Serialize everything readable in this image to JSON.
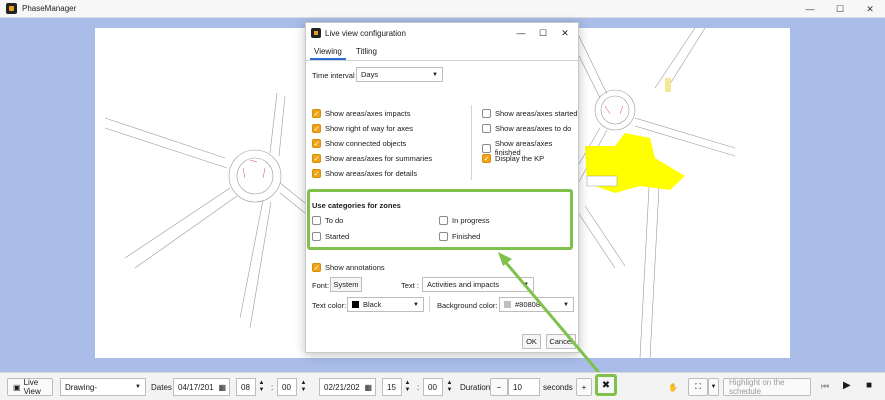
{
  "app": {
    "title": "PhaseManager"
  },
  "window_controls": {
    "minimize": "—",
    "maximize": "☐",
    "close": "✕"
  },
  "dialog": {
    "title": "Live view configuration",
    "controls": {
      "minimize": "—",
      "maximize": "☐",
      "close": "✕"
    },
    "tabs": [
      "Viewing",
      "Titling"
    ],
    "time_interval": {
      "label": "Time interval",
      "value": "Days"
    },
    "left_checks": [
      {
        "label": "Show areas/axes impacts",
        "checked": true
      },
      {
        "label": "Show right of way for axes",
        "checked": true
      },
      {
        "label": "Show connected objects",
        "checked": true
      },
      {
        "label": "Show areas/axes for summaries",
        "checked": true
      },
      {
        "label": "Show areas/axes for details",
        "checked": true
      }
    ],
    "right_checks": [
      {
        "label": "Show areas/axes started",
        "checked": false
      },
      {
        "label": "Show areas/axes to do",
        "checked": false
      },
      {
        "label": "Show areas/axes finished",
        "checked": false
      },
      {
        "label": "Display the KP",
        "checked": true
      }
    ],
    "zones": {
      "title": "Use categories for zones",
      "items": [
        {
          "label": "To do",
          "checked": false
        },
        {
          "label": "In progress",
          "checked": false
        },
        {
          "label": "Started",
          "checked": false
        },
        {
          "label": "Finished",
          "checked": false
        }
      ]
    },
    "show_annotations": {
      "label": "Show annotations",
      "checked": true
    },
    "font": {
      "label": "Font:",
      "button": "System"
    },
    "text": {
      "label": "Text :",
      "value": "Activities and impacts"
    },
    "text_color": {
      "label": "Text color:",
      "value": "Black",
      "color": "#000000"
    },
    "background_color": {
      "label": "Background color:",
      "value": "#80808",
      "color": "#c0c0c0"
    },
    "ok_label": "OK",
    "cancel_label": "Cancel"
  },
  "toolbar": {
    "live_view": "Live View",
    "drawing": "Drawing-",
    "dates_label": "Dates",
    "start_date": "04/17/201",
    "start_hour": "08",
    "start_min": "00",
    "end_date": "02/21/202",
    "end_hour": "15",
    "end_min": "00",
    "duration_label": "Duration",
    "minus": "−",
    "duration_value": "10",
    "duration_unit": "seconds",
    "plus": "+",
    "highlight_label": "Highlight on the schedule",
    "colon": ":"
  },
  "colors": {
    "accent": "#f0a418",
    "highlight": "#7fc14a",
    "workspace": "#a9bde8",
    "yellow_zone": "#ffff00"
  }
}
